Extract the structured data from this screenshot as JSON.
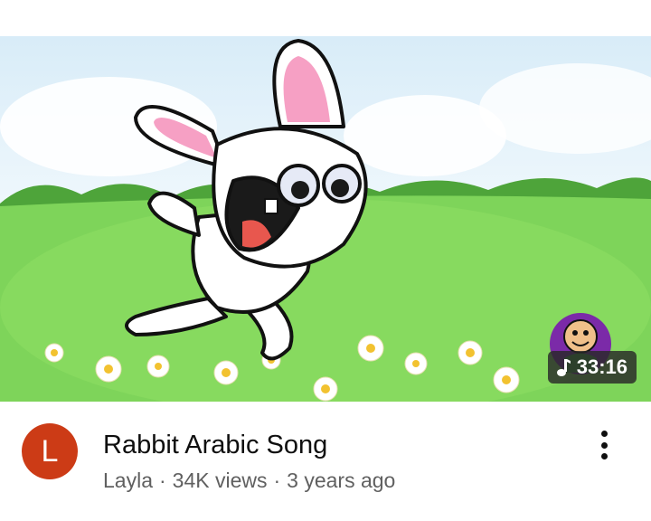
{
  "video": {
    "duration": "33:16",
    "duration_icon": "music-note-icon",
    "title": "Rabbit Arabic Song",
    "channel_initial": "L",
    "channel": "Layla",
    "views": "34K views",
    "age": "3 years ago",
    "separator": "·"
  },
  "colors": {
    "avatar": "#cc3b16",
    "title": "#0f0f0f",
    "subtitle": "#606060"
  },
  "icons": {
    "more": "vertical-ellipsis-icon"
  }
}
